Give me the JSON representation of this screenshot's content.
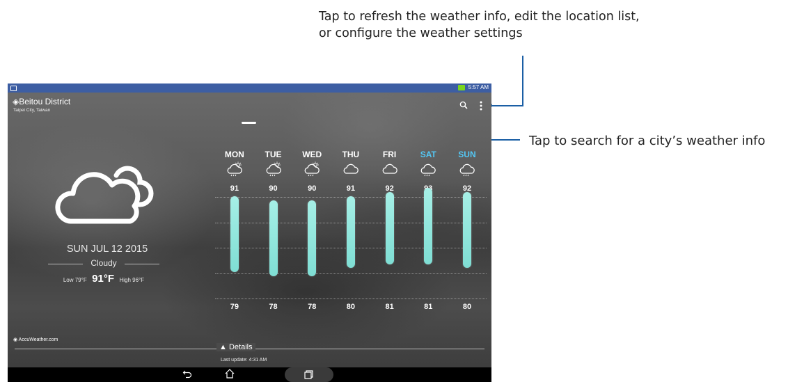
{
  "callouts": {
    "top": "Tap to refresh the weather info, edit the location list, or configure the weather settings",
    "top_line1": "Tap to refresh the weather info, edit the location list,",
    "top_line2": "or configure the weather settings",
    "right": "Tap to search for a city’s weather info"
  },
  "colors": {
    "callout_line": "#1b5fa5",
    "statusbar": "#3d5ea3",
    "weekend": "#54c8f5",
    "bar": "#8ee6dc"
  },
  "statusbar": {
    "time": "5:57 AM"
  },
  "location": {
    "name": "Beitou District",
    "sub": "Taipei City, Taiwan"
  },
  "today": {
    "date": "SUN JUL 12 2015",
    "condition": "Cloudy",
    "low": "Low 79°F",
    "current": "91°F",
    "high": "High 96°F",
    "icon": "cloud-icon"
  },
  "forecast": {
    "days": [
      {
        "label": "MON",
        "high": "91",
        "low": "79",
        "icon": "cloud-rain-sun-icon",
        "weekend": false
      },
      {
        "label": "TUE",
        "high": "90",
        "low": "78",
        "icon": "cloud-rain-sun-icon",
        "weekend": false
      },
      {
        "label": "WED",
        "high": "90",
        "low": "78",
        "icon": "cloud-rain-sun-icon",
        "weekend": false
      },
      {
        "label": "THU",
        "high": "91",
        "low": "80",
        "icon": "cloud-icon",
        "weekend": false
      },
      {
        "label": "FRI",
        "high": "92",
        "low": "81",
        "icon": "cloud-icon",
        "weekend": false
      },
      {
        "label": "SAT",
        "high": "93",
        "low": "81",
        "icon": "cloud-rain-icon",
        "weekend": true
      },
      {
        "label": "SUN",
        "high": "92",
        "low": "80",
        "icon": "cloud-rain-icon",
        "weekend": true
      }
    ]
  },
  "footer": {
    "brand": "AccuWeather.com",
    "details": "Details",
    "last_update": "Last update: 4:31 AM"
  }
}
